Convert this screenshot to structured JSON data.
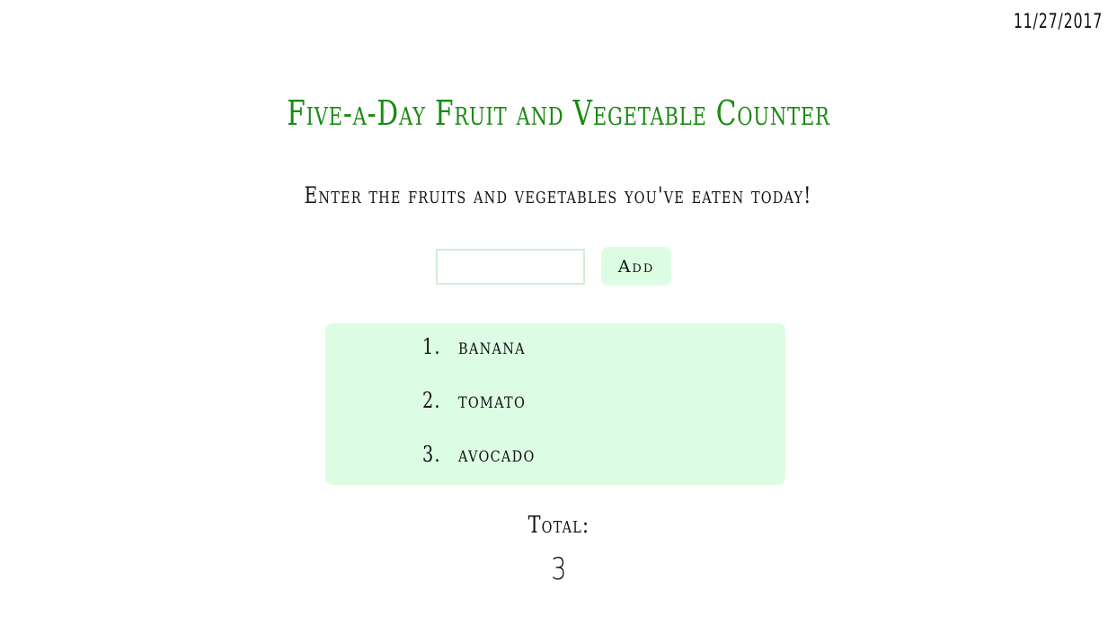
{
  "header": {
    "date": "11/27/2017",
    "title": "Five-a-Day Fruit and Vegetable Counter",
    "subtitle": "Enter the fruits and vegetables you've eaten today!"
  },
  "form": {
    "input_value": "",
    "input_placeholder": "",
    "add_label": "Add"
  },
  "list": {
    "items": [
      {
        "number": "1.",
        "name": "banana"
      },
      {
        "number": "2.",
        "name": "tomato"
      },
      {
        "number": "3.",
        "name": "avocado"
      }
    ]
  },
  "total": {
    "label": "Total:",
    "value": "3"
  },
  "colors": {
    "title": "#1a8a12",
    "accent_bg": "#dcfde3",
    "input_border": "#cfeed6"
  }
}
